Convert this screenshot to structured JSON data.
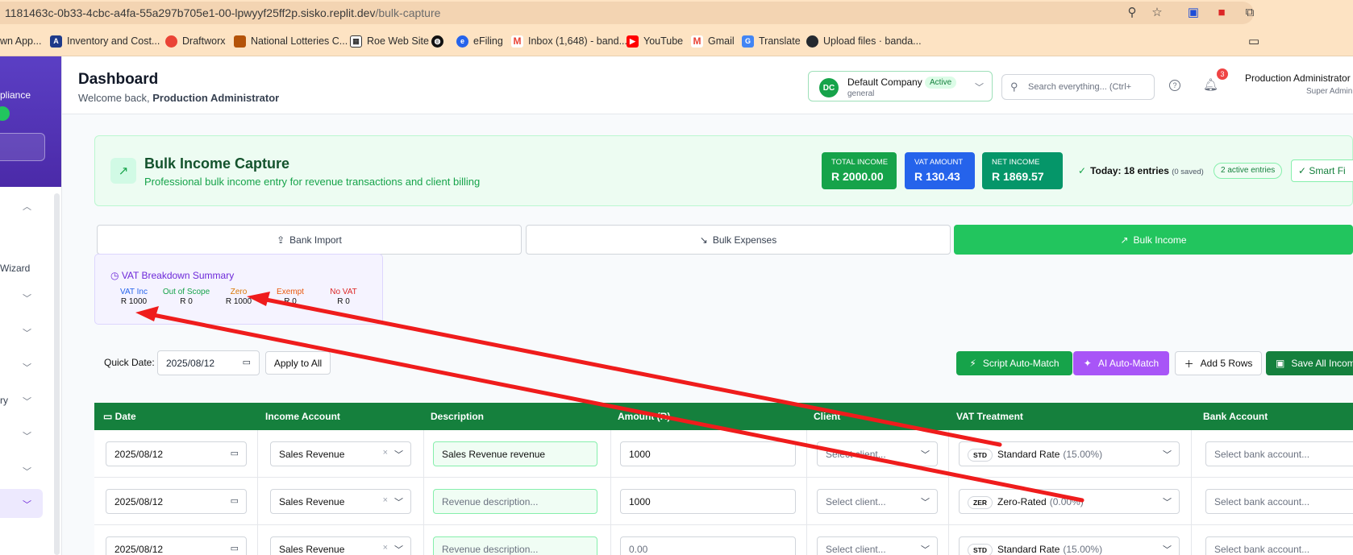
{
  "browser": {
    "url_host": "1181463c-0b33-4cbc-a4fa-55a297b705e1-00-lpwyyf25ff2p.sisko.replit.dev",
    "url_path": "/bulk-capture",
    "bookmarks": [
      "wn App...",
      "Inventory and Cost...",
      "Draftworx",
      "National Lotteries C...",
      "Roe Web Site",
      "eFiling",
      "Inbox (1,648) - band...",
      "YouTube",
      "Gmail",
      "Translate",
      "Upload files · banda..."
    ]
  },
  "sidebar": {
    "compliance": "pliance",
    "wizard": " Wizard",
    "ry": "ry"
  },
  "header": {
    "title": "Dashboard",
    "welcome": "Welcome back,",
    "user_bold": "Production Administrator",
    "company_initials": "DC",
    "company_name": "Default Company",
    "company_type": "general",
    "company_status": "Active",
    "search_placeholder": "Search everything... (Ctrl+",
    "notification_count": "3",
    "user_name": "Production Administrator",
    "user_role": "Super Admin"
  },
  "hero": {
    "title": "Bulk Income Capture",
    "subtitle": "Professional bulk income entry for revenue transactions and client billing",
    "stats": [
      {
        "label": "TOTAL INCOME",
        "value": "R 2000.00",
        "color": "#16a34a"
      },
      {
        "label": "VAT AMOUNT",
        "value": "R 130.43",
        "color": "#2563eb"
      },
      {
        "label": "NET INCOME",
        "value": "R 1869.57",
        "color": "#059669"
      }
    ],
    "today_label": "Today: 18 entries",
    "today_saved": "(0 saved)",
    "active_entries": "2 active entries",
    "smart_btn": "Smart Fi"
  },
  "tabs": [
    {
      "label": "Bank Import",
      "icon": "upload-icon"
    },
    {
      "label": "Bulk Expenses",
      "icon": "trending-down-icon"
    },
    {
      "label": "Bulk Income",
      "icon": "trending-up-icon"
    }
  ],
  "vat_summary": {
    "title": "VAT Breakdown Summary",
    "items": [
      {
        "label": "VAT Inc",
        "value": "R 1000",
        "color": "#2563eb"
      },
      {
        "label": "Out of Scope",
        "value": "R 0",
        "color": "#16a34a"
      },
      {
        "label": "Zero",
        "value": "R 1000",
        "color": "#d97706"
      },
      {
        "label": "Exempt",
        "value": "R 0",
        "color": "#ea580c"
      },
      {
        "label": "No VAT",
        "value": "R 0",
        "color": "#dc2626"
      }
    ]
  },
  "quick_date": {
    "label": "Quick Date:",
    "value": "2025/08/12",
    "apply": "Apply to All"
  },
  "actions": {
    "script_match": "Script Auto-Match",
    "ai_match": "AI Auto-Match",
    "add_rows": "Add 5 Rows",
    "save_all": "Save All Incom"
  },
  "table": {
    "headers": [
      "Date",
      "Income Account",
      "Description",
      "Amount (R)",
      "Client",
      "VAT Treatment",
      "Bank Account"
    ],
    "client_placeholder": "Select client...",
    "bank_placeholder": "Select bank account...",
    "desc_placeholder": "Revenue description...",
    "rows": [
      {
        "date": "2025/08/12",
        "account": "Sales Revenue",
        "description": "Sales Revenue revenue",
        "amount": "1000",
        "vat_code": "STD",
        "vat_name": "Standard Rate",
        "vat_pct": "(15.00%)"
      },
      {
        "date": "2025/08/12",
        "account": "Sales Revenue",
        "description": "",
        "amount": "1000",
        "vat_code": "ZER",
        "vat_name": "Zero-Rated",
        "vat_pct": "(0.00%)"
      },
      {
        "date": "2025/08/12",
        "account": "Sales Revenue",
        "description": "",
        "amount": "0.00",
        "vat_code": "STD",
        "vat_name": "Standard Rate",
        "vat_pct": "(15.00%)"
      }
    ]
  },
  "annotation_color": "#ef1c1c"
}
